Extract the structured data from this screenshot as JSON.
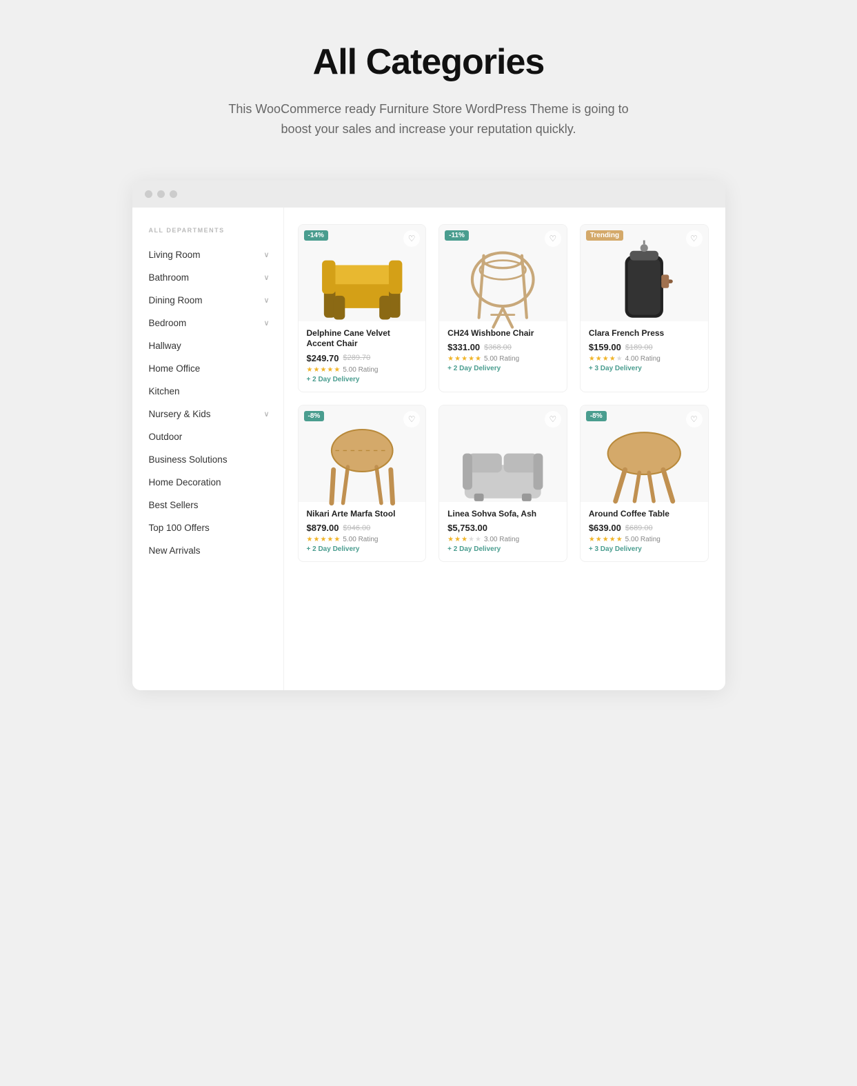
{
  "header": {
    "title": "All Categories",
    "subtitle": "This WooCommerce ready Furniture Store WordPress Theme is going to boost your sales and increase your reputation quickly."
  },
  "browser": {
    "dots": [
      "dot1",
      "dot2",
      "dot3"
    ]
  },
  "sidebar": {
    "label": "ALL DEPARTMENTS",
    "items": [
      {
        "id": "living-room",
        "label": "Living Room",
        "hasChevron": true
      },
      {
        "id": "bathroom",
        "label": "Bathroom",
        "hasChevron": true
      },
      {
        "id": "dining-room",
        "label": "Dining Room",
        "hasChevron": true
      },
      {
        "id": "bedroom",
        "label": "Bedroom",
        "hasChevron": true
      },
      {
        "id": "hallway",
        "label": "Hallway",
        "hasChevron": false
      },
      {
        "id": "home-office",
        "label": "Home Office",
        "hasChevron": false
      },
      {
        "id": "kitchen",
        "label": "Kitchen",
        "hasChevron": false
      },
      {
        "id": "nursery-kids",
        "label": "Nursery & Kids",
        "hasChevron": true
      },
      {
        "id": "outdoor",
        "label": "Outdoor",
        "hasChevron": false
      },
      {
        "id": "business-solutions",
        "label": "Business Solutions",
        "hasChevron": false
      },
      {
        "id": "home-decoration",
        "label": "Home Decoration",
        "hasChevron": false
      },
      {
        "id": "best-sellers",
        "label": "Best Sellers",
        "hasChevron": false
      },
      {
        "id": "top-100-offers",
        "label": "Top 100 Offers",
        "hasChevron": false
      },
      {
        "id": "new-arrivals",
        "label": "New Arrivals",
        "hasChevron": false
      }
    ]
  },
  "products": [
    {
      "id": "delphine-chair",
      "badge": "-14%",
      "badgeType": "discount",
      "name": "Delphine Cane Velvet Accent Chair",
      "priceCurrent": "$249.70",
      "priceOld": "$289.70",
      "ratingFull": 5,
      "ratingText": "5.00 Rating",
      "delivery": "+ 2 Day Delivery",
      "type": "chair-yellow"
    },
    {
      "id": "ch24-chair",
      "badge": "-11%",
      "badgeType": "discount",
      "name": "CH24 Wishbone Chair",
      "priceCurrent": "$331.00",
      "priceOld": "$368.00",
      "ratingFull": 5,
      "ratingText": "5.00 Rating",
      "delivery": "+ 2 Day Delivery",
      "type": "chair-wood"
    },
    {
      "id": "clara-press",
      "badge": "Trending",
      "badgeType": "trending",
      "name": "Clara French Press",
      "priceCurrent": "$159.00",
      "priceOld": "$189.00",
      "ratingFull": 4,
      "ratingText": "4.00 Rating",
      "delivery": "+ 3 Day Delivery",
      "type": "press"
    },
    {
      "id": "nikari-stool",
      "badge": "-8%",
      "badgeType": "discount",
      "name": "Nikari Arte Marfa Stool",
      "priceCurrent": "$879.00",
      "priceOld": "$946.00",
      "ratingFull": 5,
      "ratingText": "5.00 Rating",
      "delivery": "+ 2 Day Delivery",
      "type": "stool"
    },
    {
      "id": "linea-sofa",
      "badge": "",
      "badgeType": "none",
      "name": "Linea Sohva Sofa, Ash",
      "priceCurrent": "$5,753.00",
      "priceOld": "",
      "ratingFull": 3,
      "ratingText": "3.00 Rating",
      "delivery": "+ 2 Day Delivery",
      "type": "sofa"
    },
    {
      "id": "around-table",
      "badge": "-8%",
      "badgeType": "discount",
      "name": "Around Coffee Table",
      "priceCurrent": "$639.00",
      "priceOld": "$689.00",
      "ratingFull": 5,
      "ratingText": "5.00 Rating",
      "delivery": "+ 3 Day Delivery",
      "type": "coffee-table"
    }
  ]
}
